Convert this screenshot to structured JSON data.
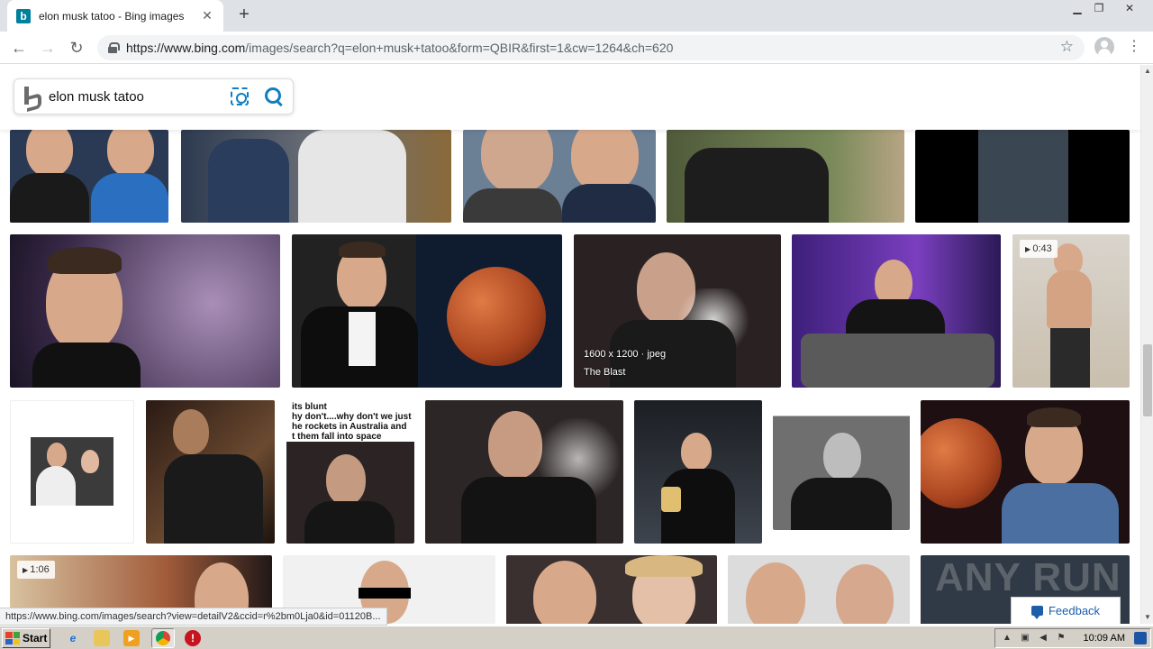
{
  "browser": {
    "tab_title": "elon musk tatoo - Bing images",
    "tab_favicon_letter": "b",
    "url_host": "https://www.bing.com",
    "url_path": "/images/search?q=elon+musk+tatoo&form=QBIR&first=1&cw=1264&ch=620"
  },
  "search": {
    "query": "elon musk tatoo"
  },
  "results": {
    "tile_smoke_dimensions": "1600 x 1200 · jpeg",
    "tile_smoke_source": "The Blast",
    "video_duration_1": "0:43",
    "video_duration_2": "1:06",
    "meme_caption": "its blunt\nhy don't....why don't we just bui\nhe rockets in Australia and\nt them fall into space"
  },
  "watermark": "ANY RUN",
  "feedback_label": "Feedback",
  "status_url": "https://www.bing.com/images/search?view=detailV2&ccid=r%2bm0Lja0&id=01120B...",
  "taskbar": {
    "start_label": "Start",
    "clock": "10:09 AM"
  }
}
